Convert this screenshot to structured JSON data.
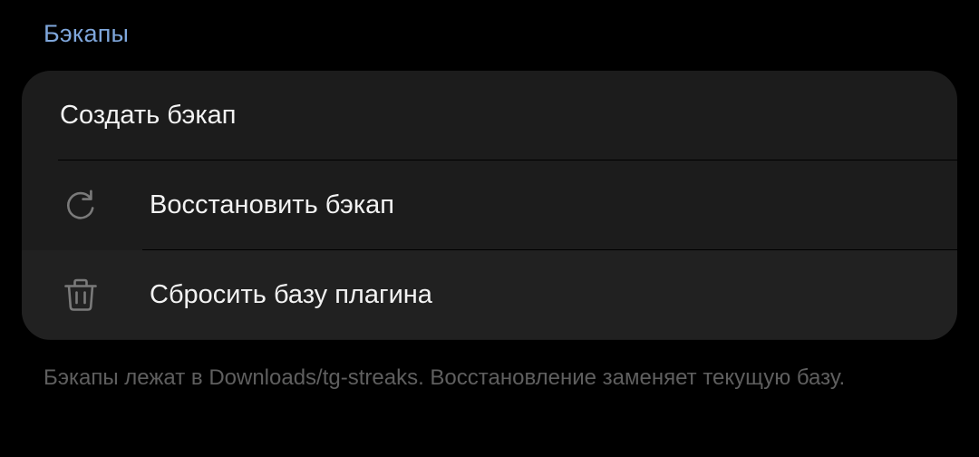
{
  "section": {
    "title": "Бэкапы"
  },
  "items": {
    "create_label": "Создать бэкап",
    "restore_label": "Восстановить бэкап",
    "restore_icon": "refresh-icon",
    "reset_label": "Сбросить базу плагина",
    "reset_icon": "trash-icon"
  },
  "footer": {
    "text": "Бэкапы лежат в Downloads/tg-streaks. Восстановление заменяет текущую базу."
  },
  "colors": {
    "background": "#000000",
    "card": "#1c1c1c",
    "accent": "#7fa7dc",
    "text": "#f2f2f2",
    "muted": "#5f5f5f",
    "icon": "#7a7a7a"
  }
}
